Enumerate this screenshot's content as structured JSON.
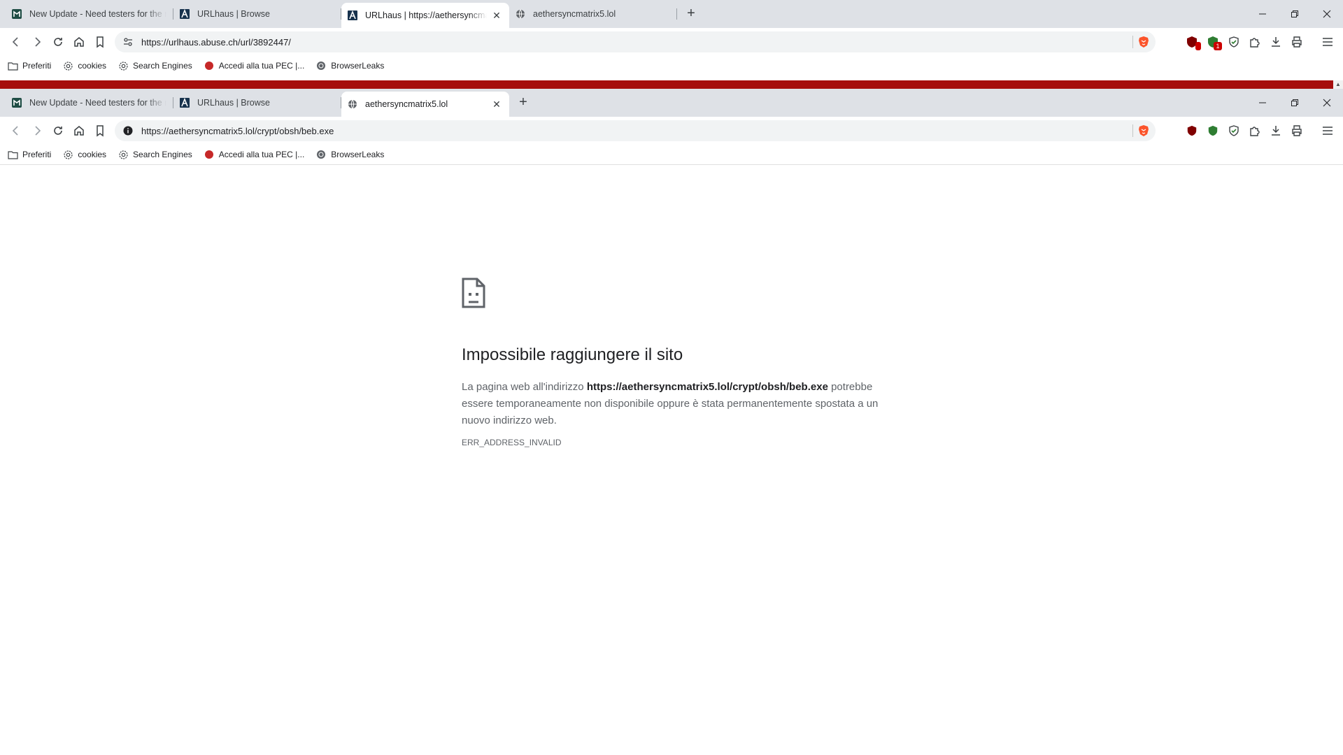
{
  "window1": {
    "tabs": [
      {
        "title": "New Update - Need testers for the new",
        "favicon": "mhouse-icon"
      },
      {
        "title": "URLhaus | Browse",
        "favicon": "urlhaus-icon"
      },
      {
        "title": "URLhaus | https://aethersyncmatrix",
        "favicon": "urlhaus-icon",
        "active": true
      },
      {
        "title": "aethersyncmatrix5.lol",
        "favicon": "globe-icon"
      }
    ],
    "address": {
      "host": "https://urlhaus.abuse.ch",
      "path": "/url/3892447/"
    },
    "extension_badges": {
      "ublock": "",
      "shield": "1"
    }
  },
  "window2": {
    "tabs": [
      {
        "title": "New Update - Need testers for the new",
        "favicon": "mhouse-icon"
      },
      {
        "title": "URLhaus | Browse",
        "favicon": "urlhaus-icon"
      },
      {
        "title": "aethersyncmatrix5.lol",
        "favicon": "globe-icon",
        "active": true
      }
    ],
    "address": {
      "host": "https://aethersyncmatrix5.lol",
      "path": "/crypt/obsh/beb.exe"
    }
  },
  "bookmarks": [
    {
      "label": "Preferiti",
      "icon": "folder-icon"
    },
    {
      "label": "cookies",
      "icon": "gear-icon"
    },
    {
      "label": "Search Engines",
      "icon": "gear-icon"
    },
    {
      "label": "Accedi alla tua PEC |...",
      "icon": "pec-icon"
    },
    {
      "label": "BrowserLeaks",
      "icon": "browserleaks-icon"
    }
  ],
  "error": {
    "title": "Impossibile raggiungere il sito",
    "desc_before": "La pagina web all'indirizzo ",
    "desc_url": "https://aethersyncmatrix5.lol/crypt/obsh/beb.exe",
    "desc_after": " potrebbe essere temporaneamente non disponibile oppure è stata permanentemente spostata a un nuovo indirizzo web.",
    "code": "ERR_ADDRESS_INVALID"
  },
  "colors": {
    "accent_red": "#a60d0d",
    "tabstrip": "#dee1e6",
    "omnibox": "#f1f3f4"
  }
}
